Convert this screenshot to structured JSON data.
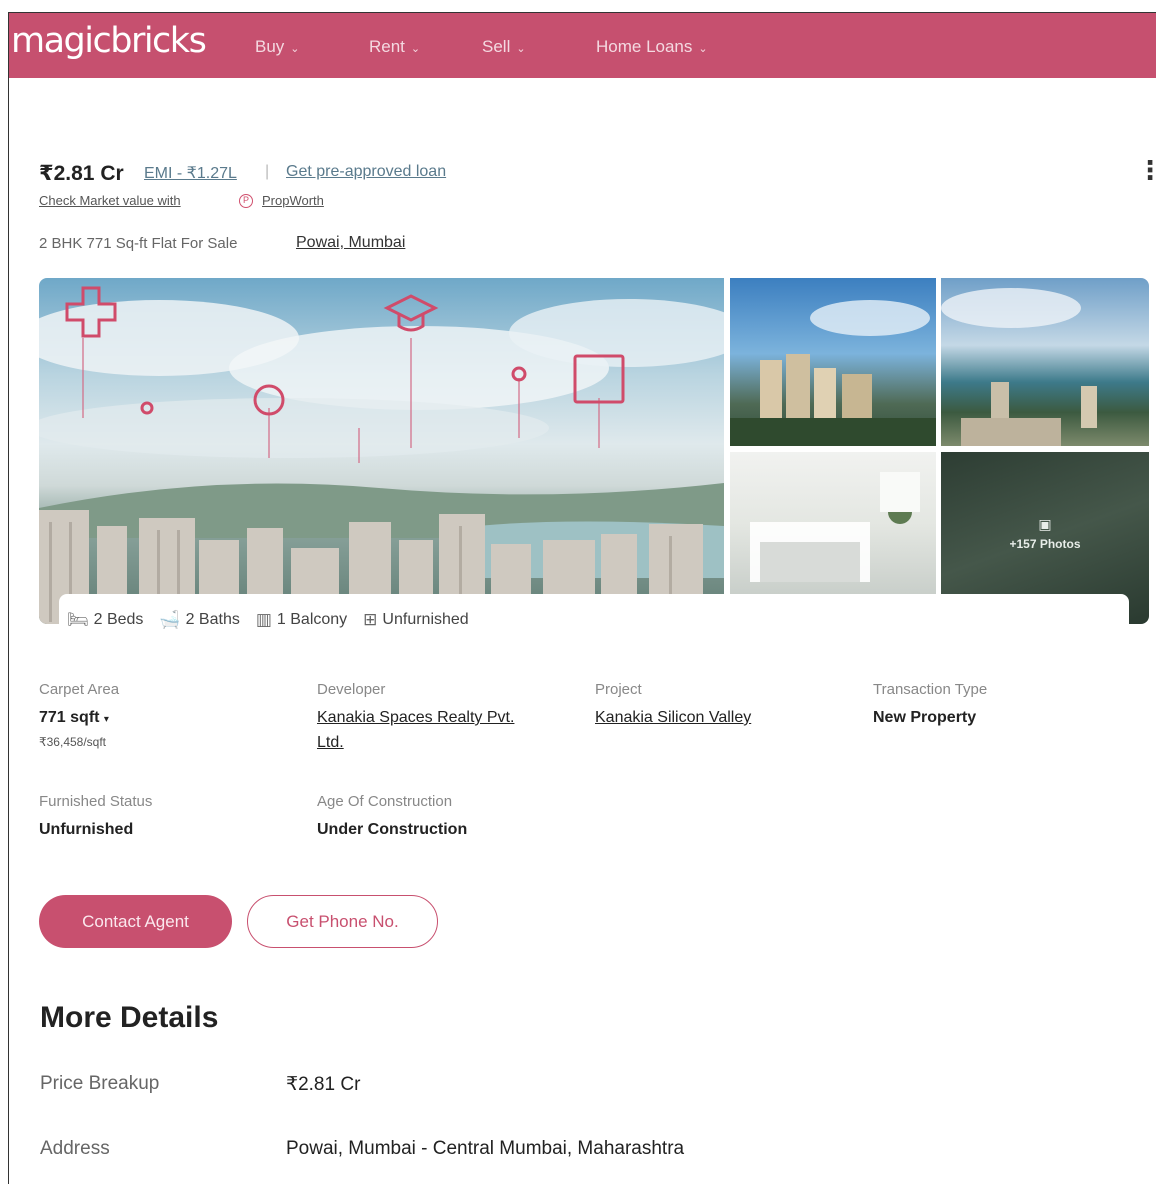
{
  "header": {
    "logo": "magicbricks",
    "nav": [
      {
        "label": "Buy"
      },
      {
        "label": "Rent"
      },
      {
        "label": "Sell"
      },
      {
        "label": "Home Loans"
      }
    ]
  },
  "listing": {
    "price": "₹2.81 Cr",
    "emi": "EMI - ₹1.27L",
    "separator": "|",
    "preapproved": "Get pre-approved loan",
    "check_market": "Check Market value with",
    "propworth": "PropWorth",
    "subtitle": "2 BHK 771 Sq-ft Flat For Sale",
    "location": "Powai, Mumbai"
  },
  "gallery": {
    "more_photos": "+157 Photos",
    "amenities": [
      {
        "icon": "bed-icon",
        "label": "2 Beds"
      },
      {
        "icon": "bath-icon",
        "label": "2 Baths"
      },
      {
        "icon": "balcony-icon",
        "label": "1 Balcony"
      },
      {
        "icon": "furnish-icon",
        "label": "Unfurnished"
      }
    ]
  },
  "specs": {
    "carpet_label": "Carpet Area",
    "carpet_val": "771 sqft",
    "carpet_rate": "₹36,458/sqft",
    "developer_label": "Developer",
    "developer_line1": "Kanakia Spaces Realty Pvt.",
    "developer_line2": "Ltd.",
    "project_label": "Project",
    "project_val": "Kanakia Silicon Valley",
    "transaction_label": "Transaction Type",
    "transaction_val": "New Property",
    "furnished_label": "Furnished Status",
    "furnished_val": "Unfurnished",
    "age_label": "Age Of Construction",
    "age_val": "Under Construction"
  },
  "actions": {
    "contact": "Contact Agent",
    "phone": "Get Phone No."
  },
  "more_details": {
    "title": "More Details",
    "price_label": "Price Breakup",
    "price_val": "₹2.81 Cr",
    "address_label": "Address",
    "address_val": "Powai, Mumbai - Central Mumbai, Maharashtra"
  },
  "colors": {
    "brand": "#c6506f",
    "link": "#5a7a8c"
  }
}
